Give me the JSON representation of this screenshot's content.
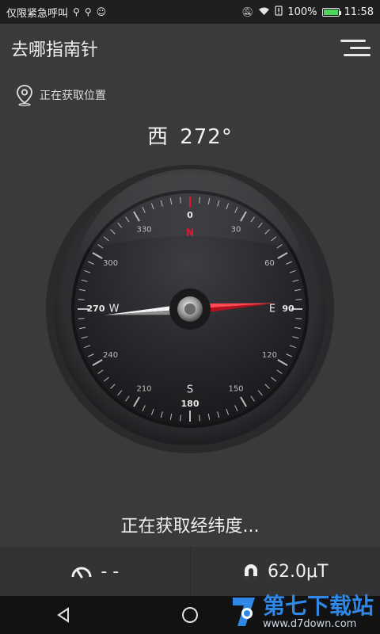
{
  "status_bar": {
    "left_text": "仅限紧急呼叫",
    "battery": "100%",
    "battery_level": 1.0,
    "time": "11:58"
  },
  "app": {
    "title": "去哪指南针"
  },
  "location": {
    "status": "正在获取位置"
  },
  "heading": {
    "direction": "西",
    "degrees": "272°"
  },
  "compass": {
    "top_mark": "0",
    "north_letter": "N",
    "east": {
      "letter": "E",
      "degree": "90"
    },
    "south": {
      "letter": "S",
      "degree": "180"
    },
    "west": {
      "letter": "W",
      "degree": "270"
    },
    "tick_labels": [
      "30",
      "60",
      "120",
      "150",
      "210",
      "240",
      "300",
      "330"
    ],
    "needle_heading_deg": 272
  },
  "message": "正在获取经纬度...",
  "readouts": {
    "speed": "- -",
    "magnetic": "62.0μT"
  },
  "watermark": {
    "title": "第七下载站",
    "url": "www.d7down.com"
  },
  "colors": {
    "background": "#3a3a3c",
    "accent_red": "#e0192e"
  }
}
